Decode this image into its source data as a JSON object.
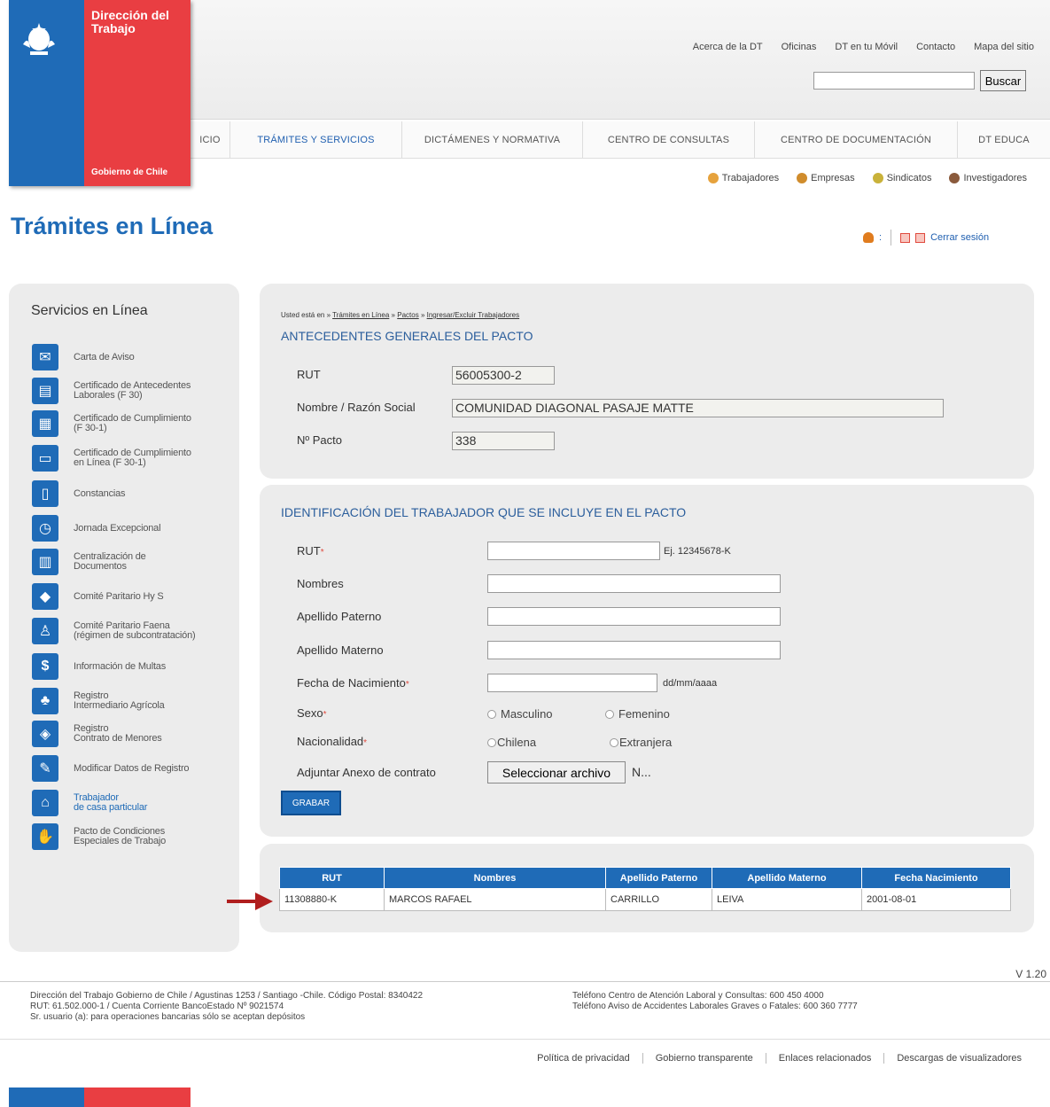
{
  "logo": {
    "title": "Dirección del Trabajo",
    "subtitle": "Gobierno de Chile"
  },
  "header": {
    "toplinks": [
      "Acerca de la DT",
      "Oficinas",
      "DT en tu Móvil",
      "Contacto",
      "Mapa del sitio"
    ],
    "search_button": "Buscar",
    "nav": [
      "ICIO",
      "TRÁMITES Y SERVICIOS",
      "DICTÁMENES Y NORMATIVA",
      "CENTRO DE CONSULTAS",
      "CENTRO DE DOCUMENTACIÓN",
      "DT EDUCA"
    ],
    "user_types": [
      "Trabajadores",
      "Empresas",
      "Sindicatos",
      "Investigadores"
    ]
  },
  "page": {
    "title": "Trámites en Línea",
    "session_sep": ":",
    "logout": "Cerrar sesión"
  },
  "sidebar": {
    "title": "Servicios en Línea",
    "items": [
      {
        "label": "Carta de Aviso",
        "icon": "mail-icon"
      },
      {
        "label": "Certificado de Antecedentes\nLaborales (F 30)",
        "icon": "certificate-icon"
      },
      {
        "label": "Certificado de Cumplimiento\n(F 30-1)",
        "icon": "document-check-icon"
      },
      {
        "label": "Certificado de Cumplimiento\nen Línea (F 30-1)",
        "icon": "monitor-icon"
      },
      {
        "label": "Constancias",
        "icon": "document-icon"
      },
      {
        "label": "Jornada Excepcional",
        "icon": "clock-icon"
      },
      {
        "label": "Centralización de\nDocumentos",
        "icon": "folders-icon"
      },
      {
        "label": "Comité Paritario Hy S",
        "icon": "committee-icon"
      },
      {
        "label": "Comité Paritario Faena\n(régimen de subcontratación)",
        "icon": "worker-icon"
      },
      {
        "label": "Información de Multas",
        "icon": "money-icon"
      },
      {
        "label": "Registro\nIntermediario Agrícola",
        "icon": "agriculture-icon"
      },
      {
        "label": "Registro\nContrato de Menores",
        "icon": "minors-icon"
      },
      {
        "label": "Modificar Datos de Registro",
        "icon": "edit-icon"
      },
      {
        "label": "Trabajador\nde casa particular",
        "icon": "house-icon"
      },
      {
        "label": "Pacto de Condiciones\nEspeciales de Trabajo",
        "icon": "handshake-icon"
      }
    ]
  },
  "breadcrumb": {
    "prefix": "Usted está en »",
    "items": [
      "Trámites en Línea",
      "Pactos",
      "Ingresar/Excluir Trabajadores"
    ],
    "sep": "»"
  },
  "general": {
    "title": "ANTECEDENTES GENERALES DEL PACTO",
    "rut_label": "RUT",
    "rut_value": "56005300-2",
    "name_label": "Nombre / Razón Social",
    "name_value": "COMUNIDAD DIAGONAL PASAJE MATTE",
    "pact_label": "Nº Pacto",
    "pact_value": "338"
  },
  "worker": {
    "title": "IDENTIFICACIÓN DEL TRABAJADOR QUE SE INCLUYE EN EL PACTO",
    "req_mark": "*",
    "rut_label": "RUT",
    "rut_hint": "Ej. 12345678-K",
    "nombres_label": "Nombres",
    "paterno_label": "Apellido Paterno",
    "materno_label": "Apellido Materno",
    "birth_label": "Fecha de Nacimiento",
    "birth_hint": "dd/mm/aaaa",
    "sex_label": "Sexo",
    "sex_options": [
      "Masculino",
      "Femenino"
    ],
    "nat_label": "Nacionalidad",
    "nat_options": [
      "Chilena",
      "Extranjera"
    ],
    "attach_label": "Adjuntar Anexo de contrato",
    "file_button": "Seleccionar archivo",
    "file_name": "N...",
    "save_button": "GRABAR"
  },
  "results": {
    "headers": [
      "RUT",
      "Nombres",
      "Apellido Paterno",
      "Apellido Materno",
      "Fecha Nacimiento"
    ],
    "rows": [
      [
        "11308880-K",
        "MARCOS RAFAEL",
        "CARRILLO",
        "LEIVA",
        "2001-08-01"
      ]
    ]
  },
  "footer": {
    "version": "V 1.20",
    "left": [
      "Dirección del Trabajo Gobierno de Chile / Agustinas 1253 / Santiago -Chile. Código Postal: 8340422",
      "RUT: 61.502.000-1 / Cuenta Corriente BancoEstado Nº 9021574",
      "Sr. usuario (a): para operaciones bancarias sólo se aceptan depósitos"
    ],
    "right": [
      "Teléfono Centro de Atención Laboral y Consultas: 600 450 4000",
      "Teléfono Aviso de Accidentes Laborales Graves o Fatales: 600 360 7777"
    ],
    "links": [
      "Política de privacidad",
      "Gobierno transparente",
      "Enlaces relacionados",
      "Descargas de visualizadores"
    ]
  },
  "colors": {
    "primary_blue": "#1f6bb7",
    "brand_red": "#e93e42",
    "panel_gray": "#ececec"
  }
}
